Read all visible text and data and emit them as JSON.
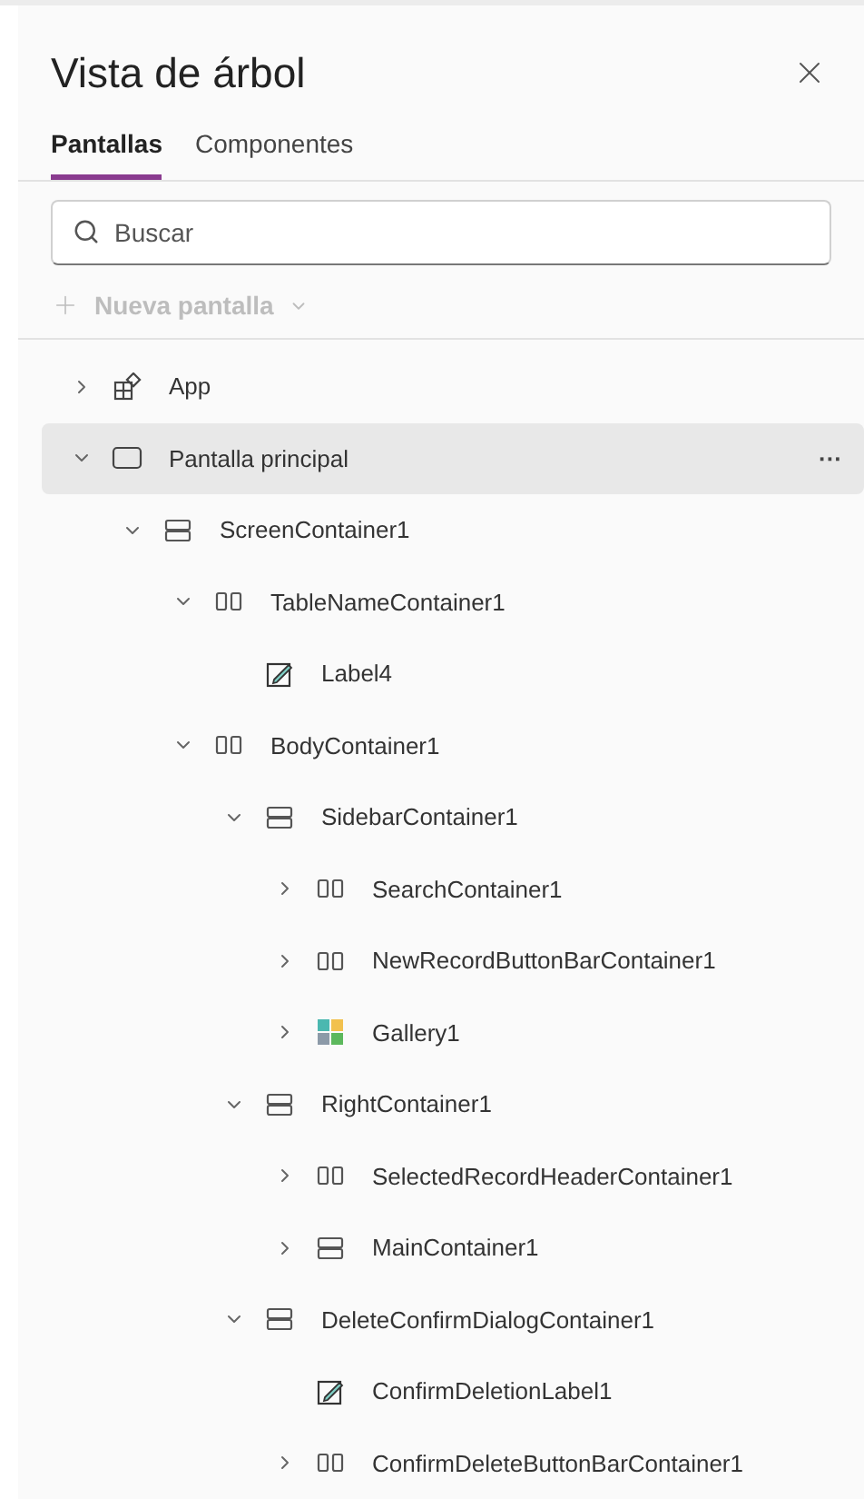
{
  "panel": {
    "title": "Vista de árbol"
  },
  "tabs": [
    {
      "label": "Pantallas",
      "selected": true
    },
    {
      "label": "Componentes",
      "selected": false
    }
  ],
  "search": {
    "placeholder": "Buscar"
  },
  "new_screen": {
    "label": "Nueva pantalla",
    "disabled": true
  },
  "tree": [
    {
      "label": "App",
      "kind": "app",
      "expanded": false,
      "selected": false
    },
    {
      "label": "Pantalla principal",
      "kind": "screen",
      "expanded": true,
      "selected": true,
      "more": "···",
      "children": [
        {
          "label": "ScreenContainer1",
          "kind": "vertical",
          "expanded": true,
          "selected": false,
          "children": [
            {
              "label": "TableNameContainer1",
              "kind": "horizontal",
              "expanded": true,
              "selected": false,
              "children": [
                {
                  "label": "Label4",
                  "kind": "label",
                  "selected": false
                }
              ]
            },
            {
              "label": "BodyContainer1",
              "kind": "horizontal",
              "expanded": true,
              "selected": false,
              "children": [
                {
                  "label": "SidebarContainer1",
                  "kind": "vertical",
                  "expanded": true,
                  "selected": false,
                  "children": [
                    {
                      "label": "SearchContainer1",
                      "kind": "horizontal",
                      "expanded": false,
                      "selected": false
                    },
                    {
                      "label": "NewRecordButtonBarContainer1",
                      "kind": "horizontal",
                      "expanded": false,
                      "selected": false
                    },
                    {
                      "label": "Gallery1",
                      "kind": "gallery",
                      "expanded": false,
                      "selected": false
                    }
                  ]
                },
                {
                  "label": "RightContainer1",
                  "kind": "vertical",
                  "expanded": true,
                  "selected": false,
                  "children": [
                    {
                      "label": "SelectedRecordHeaderContainer1",
                      "kind": "horizontal",
                      "expanded": false,
                      "selected": false
                    },
                    {
                      "label": "MainContainer1",
                      "kind": "vertical",
                      "expanded": false,
                      "selected": false
                    }
                  ]
                },
                {
                  "label": "DeleteConfirmDialogContainer1",
                  "kind": "vertical",
                  "expanded": true,
                  "selected": false,
                  "children": [
                    {
                      "label": "ConfirmDeletionLabel1",
                      "kind": "label",
                      "selected": false
                    },
                    {
                      "label": "ConfirmDeleteButtonBarContainer1",
                      "kind": "horizontal",
                      "expanded": false,
                      "selected": false
                    }
                  ]
                }
              ]
            }
          ]
        }
      ]
    }
  ]
}
